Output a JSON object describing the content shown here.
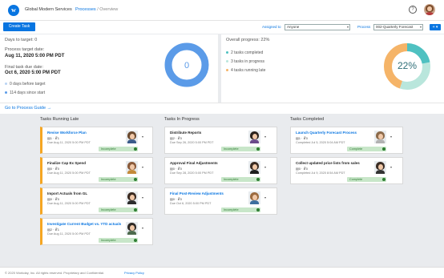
{
  "header": {
    "logo_letter": "w",
    "company": "Global Modern Services",
    "breadcrumb_link": "Processes",
    "breadcrumb_sep": "/",
    "breadcrumb_current": "Overview",
    "help": "?"
  },
  "toolbar": {
    "create_label": "Create Task",
    "assigned_label": "Assigned to",
    "assigned_value": "Anyone",
    "process_label": "Process",
    "process_value": "002-Quarterly Forecast",
    "plus": "+ ▾"
  },
  "summary": {
    "days_to_target": "Days to target: 0",
    "target_label": "Process target date:",
    "target_date": "Aug 11, 2020 5:00 PM PDT",
    "final_label": "Final task due date:",
    "final_date": "Oct 6, 2020 5:00 PM PDT",
    "before_target": "0 days before target",
    "since_start": "114 days since start",
    "donut_value": "0",
    "donut_color": "#5b9be8"
  },
  "progress": {
    "overall": "Overall progress: 22%",
    "completed": "2 tasks completed",
    "in_progress": "3 tasks in progress",
    "late": "4 tasks running late",
    "percent": "22%",
    "segments": [
      {
        "label": "completed",
        "fraction": 0.22,
        "color": "#4fc1c1"
      },
      {
        "label": "in progress",
        "fraction": 0.33,
        "color": "#b9e6dc"
      },
      {
        "label": "late",
        "fraction": 0.45,
        "color": "#f5b468"
      }
    ]
  },
  "guide": {
    "link": "Go to Process Guide →"
  },
  "columns": {
    "late": "Tasks Running Late",
    "progress": "Tasks In Progress",
    "completed": "Tasks Completed"
  },
  "late_cards": [
    {
      "title": "Revise Workforce Plan",
      "counts": "▤1  ·  ☧1",
      "date": "Due Aug 11, 2020 5:00 PM PDT",
      "status": "Incomplete"
    },
    {
      "title": "Finalize Cap Ex Spend",
      "counts": "▤0  ·  ☧0",
      "date": "Due Aug 11, 2020 5:00 PM PDT",
      "status": "Incomplete"
    },
    {
      "title": "Import Actuals from GL",
      "counts": "▤0  ·  ☧0",
      "date": "Due Aug 11, 2020 5:00 PM PDT",
      "status": "Incomplete"
    },
    {
      "title": "Investigate Current Budget vs. YTD actuals",
      "counts": "▤2  ·  ☧1",
      "date": "Due Aug 11, 2020 5:00 PM PDT",
      "status": "Incomplete"
    }
  ],
  "progress_cards": [
    {
      "title": "Distribute Reports",
      "counts": "▤2  ·  ☧0",
      "date": "Due Sep 26, 2020 5:00 PM PDT",
      "status": "Incomplete"
    },
    {
      "title": "Approval Final Adjustments",
      "counts": "▤0  ·  ☧0",
      "date": "Due Sep 28, 2020 5:00 PM PDT",
      "status": "Incomplete"
    },
    {
      "title": "Final Post-Review Adjustments",
      "counts": "▤0  ·  ☧0",
      "date": "Due Oct 6, 2020 5:00 PM PDT",
      "status": "Incomplete"
    }
  ],
  "completed_cards": [
    {
      "title": "Launch Quarterly Forecast Process",
      "counts": "▤1  ·  ☧0",
      "date": "Completed Jul 5, 2020 5:04 AM PDT",
      "status": "Complete"
    },
    {
      "title": "Collect updated price lists from sales",
      "counts": "▤0  ·  ☧0",
      "date": "Completed Jul 9, 2020 8:54 AM PDT",
      "status": "Complete"
    }
  ],
  "footer": {
    "copyright": "© 2020 Workday, Inc. All rights reserved. Proprietary and Confidential.",
    "privacy": "Privacy Policy"
  }
}
